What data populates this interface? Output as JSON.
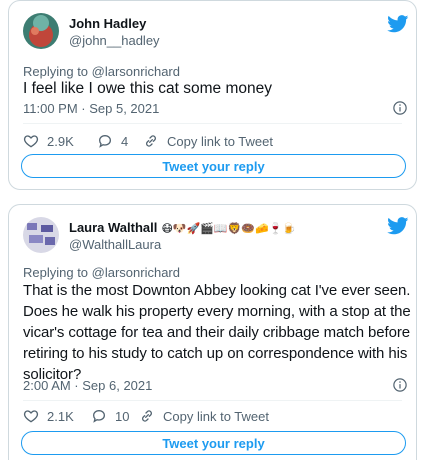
{
  "tweets": [
    {
      "name": "John Hadley",
      "handle": "@john__hadley",
      "replying_to": "Replying to @larsonrichard",
      "text": "I feel like I owe this cat some money",
      "time": "11:00 PM · Sep 5, 2021",
      "likes": "2.9K",
      "replies": "4",
      "copy_link": "Copy link to Tweet",
      "reply_button": "Tweet your reply"
    },
    {
      "name": "Laura Walthall",
      "name_emojis": "😷🐶🚀🎬📖🦁🍩🧀🍷🍺",
      "handle": "@WalthallLaura",
      "replying_to": "Replying to @larsonrichard",
      "text": "That is the most Downton Abbey looking cat I've ever seen. Does he walk his property every morning, with a stop at the vicar's cottage for tea and their daily cribbage match before retiring to his study to catch up on correspondence with his solicitor?",
      "time": "2:00 AM · Sep 6, 2021",
      "likes": "2.1K",
      "replies": "10",
      "copy_link": "Copy link to Tweet",
      "reply_button": "Tweet your reply"
    }
  ],
  "colors": {
    "accent": "#1d9bf0",
    "secondary_text": "#536471",
    "border": "#cfd9de"
  },
  "icons": [
    "twitter-bird-icon",
    "info-icon",
    "heart-icon",
    "reply-bubble-icon",
    "link-icon"
  ]
}
